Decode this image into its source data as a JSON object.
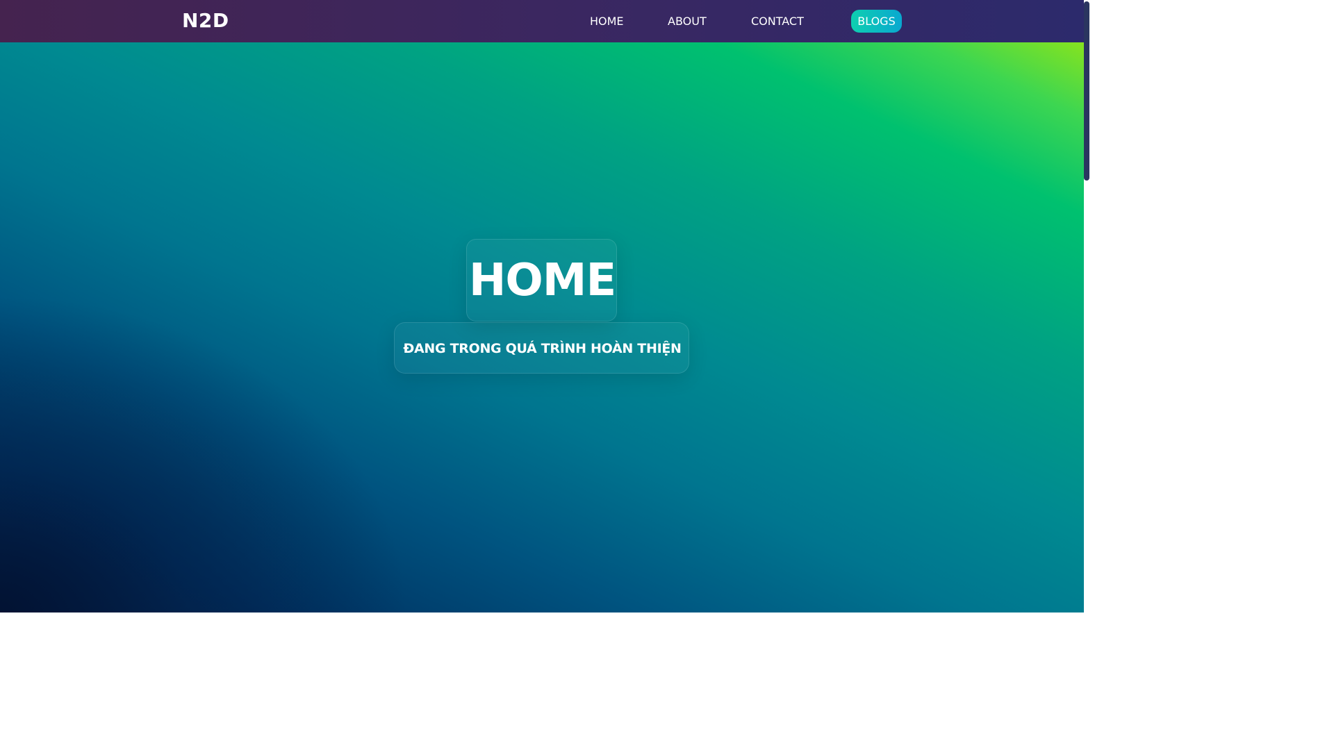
{
  "navbar": {
    "logo": "N2D",
    "links": [
      "HOME",
      "ABOUT",
      "CONTACT"
    ],
    "cta": "BLOGS"
  },
  "hero": {
    "title": "HOME",
    "subtitle": "ĐANG TRONG QUÁ TRÌNH HOÀN THIỆN"
  },
  "colors": {
    "navbar_left": "#45234f",
    "navbar_right": "#2c2a6c",
    "blogs_button_start": "#0ecfb0",
    "blogs_button_end": "#0aa8d0",
    "hero_top_right": "#86e31f",
    "hero_mid": "#008a91",
    "hero_bottom_left": "#021b40"
  }
}
